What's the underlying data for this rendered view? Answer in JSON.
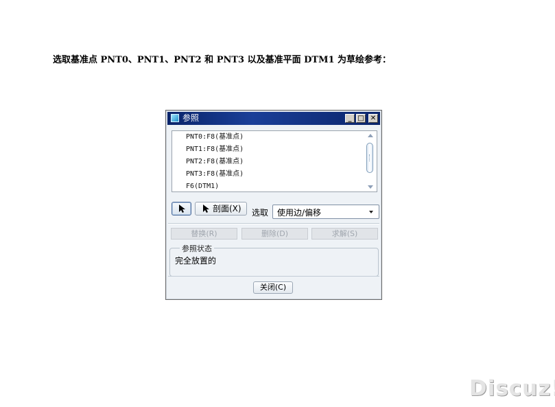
{
  "caption": "选取基准点 PNT0、PNT1、PNT2  和 PNT3 以及基准平面 DTM1 为草绘参考：",
  "dialog": {
    "title": "参照",
    "title_icon": "window-icon",
    "window_buttons": {
      "minimize": "_",
      "maximize": "□",
      "close": "✕"
    },
    "references": [
      "PNT0:F8(基准点)",
      "PNT1:F8(基准点)",
      "PNT2:F8(基准点)",
      "PNT3:F8(基准点)",
      "F6(DTM1)"
    ],
    "pick_icon": "arrow-cursor-icon",
    "section_button": "剖面(X)",
    "select_label": "选取",
    "select_value": "使用边/偏移",
    "actions": {
      "replace": "替换(R)",
      "delete": "删除(D)",
      "solve": "求解(S)"
    },
    "status_group": {
      "title": "参照状态",
      "value": "完全放置的"
    },
    "close_button": "关闭(C)"
  },
  "watermark": "Discuz!"
}
